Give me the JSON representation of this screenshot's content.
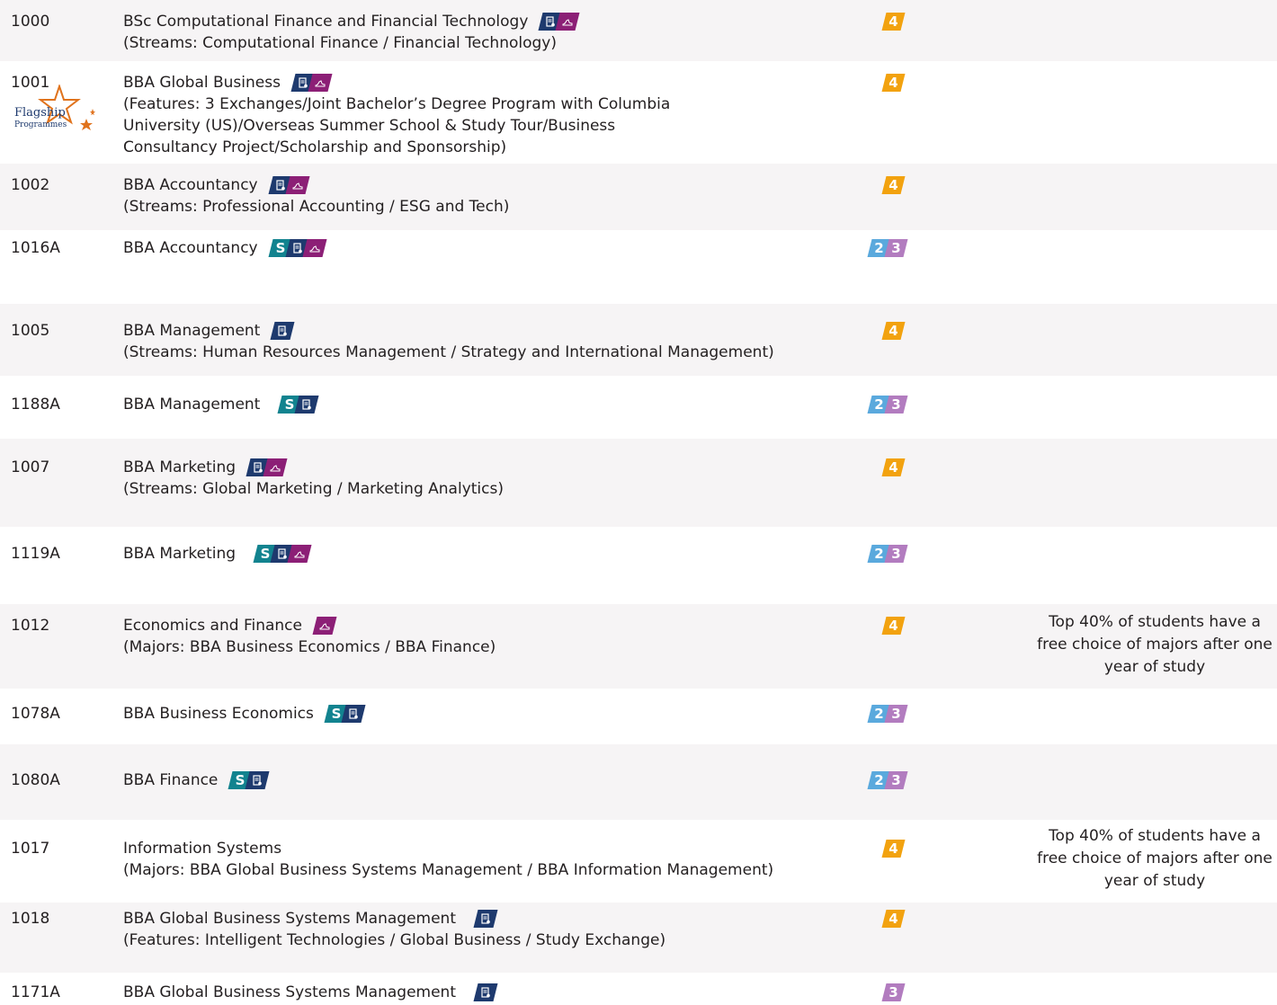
{
  "colors": {
    "stream_icon": "#12838f",
    "document_icon": "#1e3a6e",
    "exchange_icon": "#8c1f76",
    "year_4": "#f2a20f",
    "year_2": "#5aa9dd",
    "year_3": "#b27cbf",
    "row_shade": "#f6f4f5"
  },
  "flagship_badge": {
    "line1": "Flagship",
    "line2": "Programmes"
  },
  "programmes": [
    {
      "code": "1000",
      "title": "BSc Computational Finance and Financial Technology",
      "details": [
        "(Streams: Computational Finance / Financial Technology)"
      ],
      "icons": [
        "document-icon",
        "exchange-icon"
      ],
      "years": [
        "4"
      ],
      "remark": ""
    },
    {
      "code": "1001",
      "title": "BBA Global Business",
      "details": [
        "(Features: 3 Exchanges/Joint Bachelor’s Degree Program with Columbia",
        "University (US)/Overseas Summer School & Study Tour/Business",
        "Consultancy Project/Scholarship and Sponsorship)"
      ],
      "icons": [
        "document-icon",
        "exchange-icon"
      ],
      "years": [
        "4"
      ],
      "remark": ""
    },
    {
      "code": "1002",
      "title": "BBA Accountancy",
      "details": [
        "(Streams: Professional Accounting / ESG and Tech)"
      ],
      "icons": [
        "document-icon",
        "exchange-icon"
      ],
      "years": [
        "4"
      ],
      "remark": ""
    },
    {
      "code": "1016A",
      "title": "BBA Accountancy",
      "details": [],
      "icons": [
        "stream-icon",
        "document-icon",
        "exchange-icon"
      ],
      "years": [
        "2",
        "3"
      ],
      "remark": ""
    },
    {
      "code": "1005",
      "title": "BBA Management",
      "details": [
        "(Streams: Human Resources Management / Strategy and International Management)"
      ],
      "icons": [
        "document-icon"
      ],
      "years": [
        "4"
      ],
      "remark": ""
    },
    {
      "code": "1188A",
      "title": "BBA Management",
      "details": [],
      "icons": [
        "stream-icon",
        "document-icon"
      ],
      "years": [
        "2",
        "3"
      ],
      "remark": ""
    },
    {
      "code": "1007",
      "title": "BBA Marketing",
      "details": [
        "(Streams: Global Marketing / Marketing Analytics)"
      ],
      "icons": [
        "document-icon",
        "exchange-icon"
      ],
      "years": [
        "4"
      ],
      "remark": ""
    },
    {
      "code": "1119A",
      "title": "BBA Marketing",
      "details": [],
      "icons": [
        "stream-icon",
        "document-icon",
        "exchange-icon"
      ],
      "years": [
        "2",
        "3"
      ],
      "remark": ""
    },
    {
      "code": "1012",
      "title": "Economics and Finance",
      "details": [
        "(Majors: BBA Business Economics / BBA Finance)"
      ],
      "icons": [
        "exchange-icon"
      ],
      "years": [
        "4"
      ],
      "remark": "Top 40% of students have a free choice of majors after one year of study"
    },
    {
      "code": "1078A",
      "title": "BBA Business Economics",
      "details": [],
      "icons": [
        "stream-icon",
        "document-icon"
      ],
      "years": [
        "2",
        "3"
      ],
      "remark": ""
    },
    {
      "code": "1080A",
      "title": "BBA Finance",
      "details": [],
      "icons": [
        "stream-icon",
        "document-icon"
      ],
      "years": [
        "2",
        "3"
      ],
      "remark": ""
    },
    {
      "code": "1017",
      "title": "Information Systems",
      "details": [
        "(Majors: BBA Global Business Systems Management / BBA Information Management)"
      ],
      "icons": [],
      "years": [
        "4"
      ],
      "remark": "Top 40% of students have a free choice of majors after one year of study"
    },
    {
      "code": "1018",
      "title": "BBA Global Business Systems Management",
      "details": [
        "(Features: Intelligent Technologies / Global Business / Study Exchange)"
      ],
      "icons": [
        "document-icon"
      ],
      "years": [
        "4"
      ],
      "remark": ""
    },
    {
      "code": "1171A",
      "title": "BBA Global Business Systems Management",
      "details": [],
      "icons": [
        "document-icon"
      ],
      "years": [
        "3"
      ],
      "remark": ""
    }
  ]
}
